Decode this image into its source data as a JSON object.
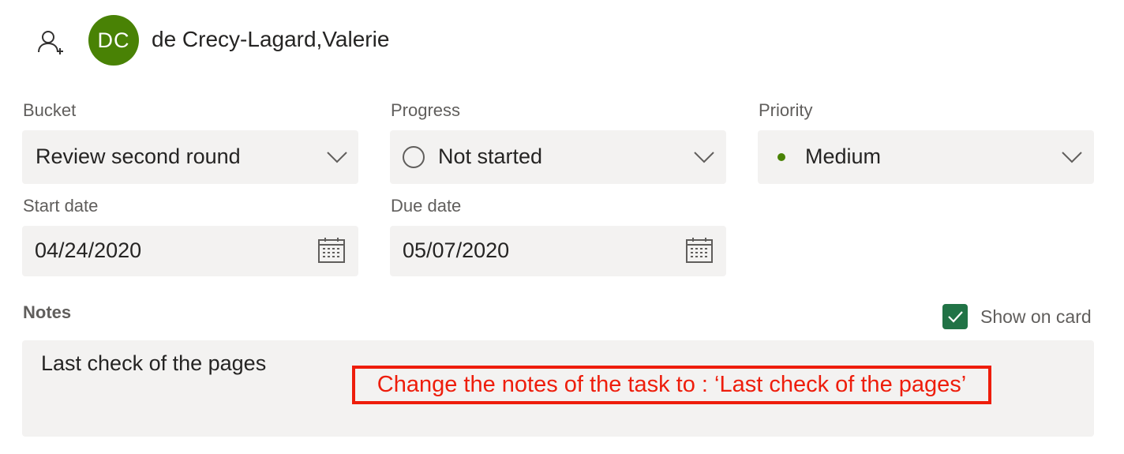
{
  "assignment": {
    "assign_icon": "add-person-icon",
    "avatar_initials": "DC",
    "avatar_color": "#498205",
    "assignee_name": "de Crecy-Lagard,Valerie"
  },
  "bucket": {
    "label": "Bucket",
    "value": "Review second round",
    "icon": "chevron-down-icon"
  },
  "progress": {
    "label": "Progress",
    "value": "Not started",
    "status_icon": "empty-circle-icon",
    "icon": "chevron-down-icon"
  },
  "priority": {
    "label": "Priority",
    "value": "Medium",
    "dot_color": "#498205",
    "icon": "chevron-down-icon"
  },
  "start_date": {
    "label": "Start date",
    "value": "04/24/2020",
    "icon": "calendar-icon"
  },
  "due_date": {
    "label": "Due date",
    "value": "05/07/2020",
    "icon": "calendar-icon"
  },
  "notes": {
    "label": "Notes",
    "show_on_card_label": "Show on card",
    "show_on_card_checked": true,
    "value": "Last check of the pages"
  },
  "instruction": {
    "text": "Change the notes of the task to : ‘Last check of the pages’",
    "color": "#ee1d0b"
  },
  "colors": {
    "field_background": "#f3f2f1",
    "checkbox_green": "#217346"
  }
}
